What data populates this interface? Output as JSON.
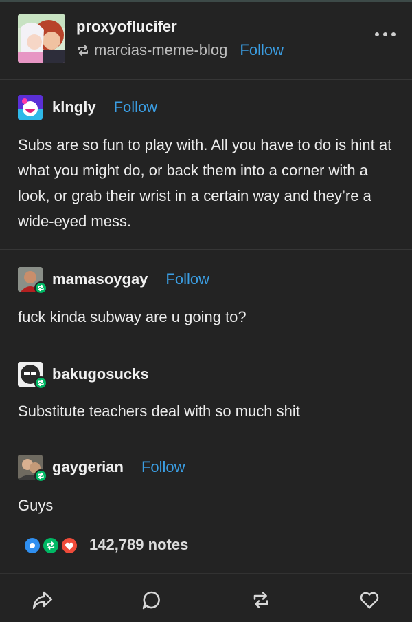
{
  "header": {
    "blog_name": "proxyoflucifer",
    "reblogged_from": "marcias-meme-blog",
    "follow_label": "Follow",
    "avatar_icon": "anime-avatar-icon",
    "more_icon": "more-options-icon"
  },
  "trail": [
    {
      "name": "klngly",
      "follow_label": "Follow",
      "body": "Subs are so fun to play with. All you have to do is hint at what you might do, or back them into a corner with a look, or grab their wrist in a certain way and they’re a wide-eyed mess."
    },
    {
      "name": "mamasoygay",
      "follow_label": "Follow",
      "body": "fuck kinda subway are u going to?"
    },
    {
      "name": "bakugosucks",
      "body": "Substitute teachers deal with so much shit"
    },
    {
      "name": "gaygerian",
      "follow_label": "Follow",
      "body": "Guys"
    }
  ],
  "notes": {
    "count_label": "142,789 notes",
    "icons": [
      "comment-icon",
      "reblog-icon",
      "like-icon"
    ],
    "colors": {
      "comment": "#2f8ff0",
      "reblog": "#00b864",
      "like": "#ef4b3a"
    }
  },
  "actions": {
    "icons": [
      "share-icon",
      "reply-icon",
      "reblog-icon",
      "like-icon"
    ]
  },
  "colors": {
    "background": "#232323",
    "follow": "#3b9ee3",
    "text": "#ececec"
  }
}
